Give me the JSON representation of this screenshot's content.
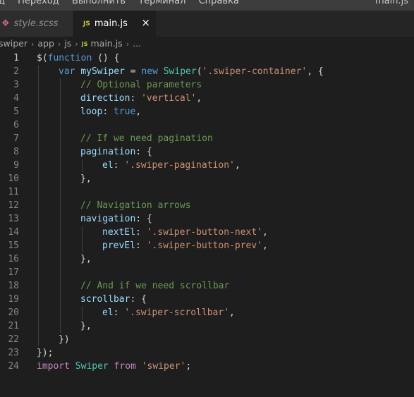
{
  "menubar": {
    "items": [
      "д",
      "Переход",
      "Выполнить",
      "Терминал",
      "Справка"
    ],
    "window_title": "main.js"
  },
  "tabs": [
    {
      "label": "style.scss",
      "icon": "sass-icon",
      "active": false
    },
    {
      "label": "main.js",
      "icon": "js-icon",
      "icon_text": "JS",
      "active": true,
      "close": "×"
    }
  ],
  "breadcrumb": {
    "items": [
      "swiper",
      "app",
      "js",
      "main.js",
      "..."
    ],
    "separator": "›",
    "file_icon_text": "JS"
  },
  "colors": {
    "editor_bg": "#1e1e1e",
    "keyword": "#569cd6",
    "string": "#ce9178",
    "comment": "#6a9955",
    "property": "#9cdcfe",
    "class": "#4ec9b0"
  },
  "editor": {
    "active_line": 1,
    "lines": [
      {
        "n": "1",
        "indent": 0,
        "tokens": [
          [
            "plain",
            "$("
          ],
          [
            "kw",
            "function"
          ],
          [
            "plain",
            " () {"
          ]
        ]
      },
      {
        "n": "2",
        "indent": 1,
        "tokens": [
          [
            "kw",
            "var"
          ],
          [
            "plain",
            " "
          ],
          [
            "var",
            "mySwiper"
          ],
          [
            "plain",
            " = "
          ],
          [
            "kw",
            "new"
          ],
          [
            "plain",
            " "
          ],
          [
            "class",
            "Swiper"
          ],
          [
            "plain",
            "("
          ],
          [
            "str",
            "'.swiper-container'"
          ],
          [
            "plain",
            ", {"
          ]
        ]
      },
      {
        "n": "3",
        "indent": 2,
        "tokens": [
          [
            "cmt",
            "// Optional parameters"
          ]
        ]
      },
      {
        "n": "4",
        "indent": 2,
        "tokens": [
          [
            "var",
            "direction"
          ],
          [
            "plain",
            ": "
          ],
          [
            "str",
            "'vertical'"
          ],
          [
            "plain",
            ","
          ]
        ]
      },
      {
        "n": "5",
        "indent": 2,
        "tokens": [
          [
            "var",
            "loop"
          ],
          [
            "plain",
            ": "
          ],
          [
            "kw",
            "true"
          ],
          [
            "plain",
            ","
          ]
        ]
      },
      {
        "n": "6",
        "indent": 2,
        "tokens": []
      },
      {
        "n": "7",
        "indent": 2,
        "tokens": [
          [
            "cmt",
            "// If we need pagination"
          ]
        ]
      },
      {
        "n": "8",
        "indent": 2,
        "tokens": [
          [
            "var",
            "pagination"
          ],
          [
            "plain",
            ": {"
          ]
        ]
      },
      {
        "n": "9",
        "indent": 3,
        "tokens": [
          [
            "var",
            "el"
          ],
          [
            "plain",
            ": "
          ],
          [
            "str",
            "'.swiper-pagination'"
          ],
          [
            "plain",
            ","
          ]
        ]
      },
      {
        "n": "10",
        "indent": 2,
        "tokens": [
          [
            "plain",
            "},"
          ]
        ]
      },
      {
        "n": "11",
        "indent": 2,
        "tokens": []
      },
      {
        "n": "12",
        "indent": 2,
        "tokens": [
          [
            "cmt",
            "// Navigation arrows"
          ]
        ]
      },
      {
        "n": "13",
        "indent": 2,
        "tokens": [
          [
            "var",
            "navigation"
          ],
          [
            "plain",
            ": {"
          ]
        ]
      },
      {
        "n": "14",
        "indent": 3,
        "tokens": [
          [
            "var",
            "nextEl"
          ],
          [
            "plain",
            ": "
          ],
          [
            "str",
            "'.swiper-button-next'"
          ],
          [
            "plain",
            ","
          ]
        ]
      },
      {
        "n": "15",
        "indent": 3,
        "tokens": [
          [
            "var",
            "prevEl"
          ],
          [
            "plain",
            ": "
          ],
          [
            "str",
            "'.swiper-button-prev'"
          ],
          [
            "plain",
            ","
          ]
        ]
      },
      {
        "n": "16",
        "indent": 2,
        "tokens": [
          [
            "plain",
            "},"
          ]
        ]
      },
      {
        "n": "17",
        "indent": 2,
        "tokens": []
      },
      {
        "n": "18",
        "indent": 2,
        "tokens": [
          [
            "cmt",
            "// And if we need scrollbar"
          ]
        ]
      },
      {
        "n": "19",
        "indent": 2,
        "tokens": [
          [
            "var",
            "scrollbar"
          ],
          [
            "plain",
            ": {"
          ]
        ]
      },
      {
        "n": "20",
        "indent": 3,
        "tokens": [
          [
            "var",
            "el"
          ],
          [
            "plain",
            ": "
          ],
          [
            "str",
            "'.swiper-scrollbar'"
          ],
          [
            "plain",
            ","
          ]
        ]
      },
      {
        "n": "21",
        "indent": 2,
        "tokens": [
          [
            "plain",
            "},"
          ]
        ]
      },
      {
        "n": "22",
        "indent": 1,
        "tokens": [
          [
            "plain",
            "})"
          ]
        ]
      },
      {
        "n": "23",
        "indent": 0,
        "tokens": [
          [
            "plain",
            "});"
          ]
        ]
      },
      {
        "n": "24",
        "indent": 0,
        "tokens": [
          [
            "ctrl",
            "import"
          ],
          [
            "plain",
            " "
          ],
          [
            "class",
            "Swiper"
          ],
          [
            "plain",
            " "
          ],
          [
            "ctrl",
            "from"
          ],
          [
            "plain",
            " "
          ],
          [
            "str",
            "'swiper'"
          ],
          [
            "plain",
            ";"
          ]
        ]
      }
    ]
  }
}
